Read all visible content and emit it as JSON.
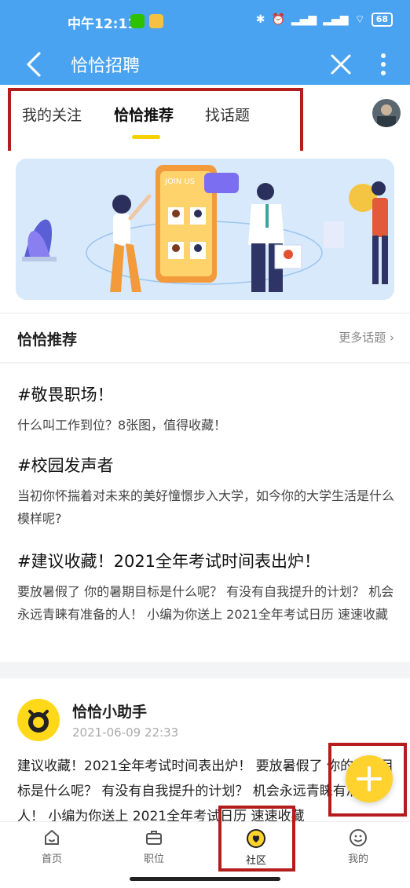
{
  "status_bar": {
    "time": "中午12:11",
    "battery": "68"
  },
  "title_bar": {
    "title": "恰恰招聘"
  },
  "tabs": [
    {
      "label": "我的关注",
      "active": false
    },
    {
      "label": "恰恰推荐",
      "active": true
    },
    {
      "label": "找话题",
      "active": false
    }
  ],
  "banner": {
    "join_text": "JOIN US"
  },
  "section": {
    "title": "恰恰推荐",
    "more_label": "更多话题"
  },
  "topics": [
    {
      "title": "#敬畏职场！",
      "desc": "什么叫工作到位？8张图，值得收藏！"
    },
    {
      "title": "#校园发声者",
      "desc": "当初你怀揣着对未来的美好憧憬步入大学，如今你的大学生活是什么模样呢?"
    },
    {
      "title": "#建议收藏！2021全年考试时间表出炉！",
      "desc": "要放暑假了 你的暑期目标是什么呢？ 有没有自我提升的计划？ 机会永远青睐有准备的人！ 小编为你送上 2021全年考试日历 速速收藏"
    }
  ],
  "post": {
    "author": "恰恰小助手",
    "date": "2021-06-09 22:33",
    "body": "建议收藏！2021全年考试时间表出炉！ 要放暑假了 你的暑期目标是什么呢？ 有没有自我提升的计划？ 机会永远青睐有准备的人！ 小编为你送上 2021全年考试日历 速速收藏"
  },
  "bottom_nav": [
    {
      "label": "首页",
      "icon": "home-icon",
      "active": false
    },
    {
      "label": "职位",
      "icon": "briefcase-icon",
      "active": false
    },
    {
      "label": "社区",
      "icon": "community-icon",
      "active": true
    },
    {
      "label": "我的",
      "icon": "profile-icon",
      "active": false
    }
  ],
  "colors": {
    "header_blue": "#4aa3f0",
    "accent_yellow": "#ffd22d",
    "highlight_red": "#b51c1c"
  }
}
